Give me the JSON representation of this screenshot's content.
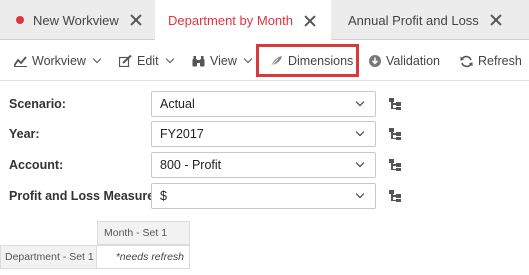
{
  "tabs": [
    {
      "label": "New Workview",
      "dot_color": "#e0333f"
    },
    {
      "label": "Department by Month",
      "active_color": "#e0333f"
    },
    {
      "label": "Annual Profit and Loss"
    }
  ],
  "toolbar": {
    "workview": "Workview",
    "edit": "Edit",
    "view": "View",
    "dimensions": "Dimensions",
    "validation": "Validation",
    "refresh": "Refresh",
    "highlight_color": "#d63b3b"
  },
  "form": {
    "scenario": {
      "label": "Scenario:",
      "value": "Actual"
    },
    "year": {
      "label": "Year:",
      "value": "FY2017"
    },
    "account": {
      "label": "Account:",
      "value": "800 - Profit"
    },
    "measures": {
      "label": "Profit and Loss Measures:",
      "value": "$"
    }
  },
  "grid": {
    "column_header": "Month - Set 1",
    "row_header": "Department - Set 1",
    "cell": "*needs refresh"
  }
}
